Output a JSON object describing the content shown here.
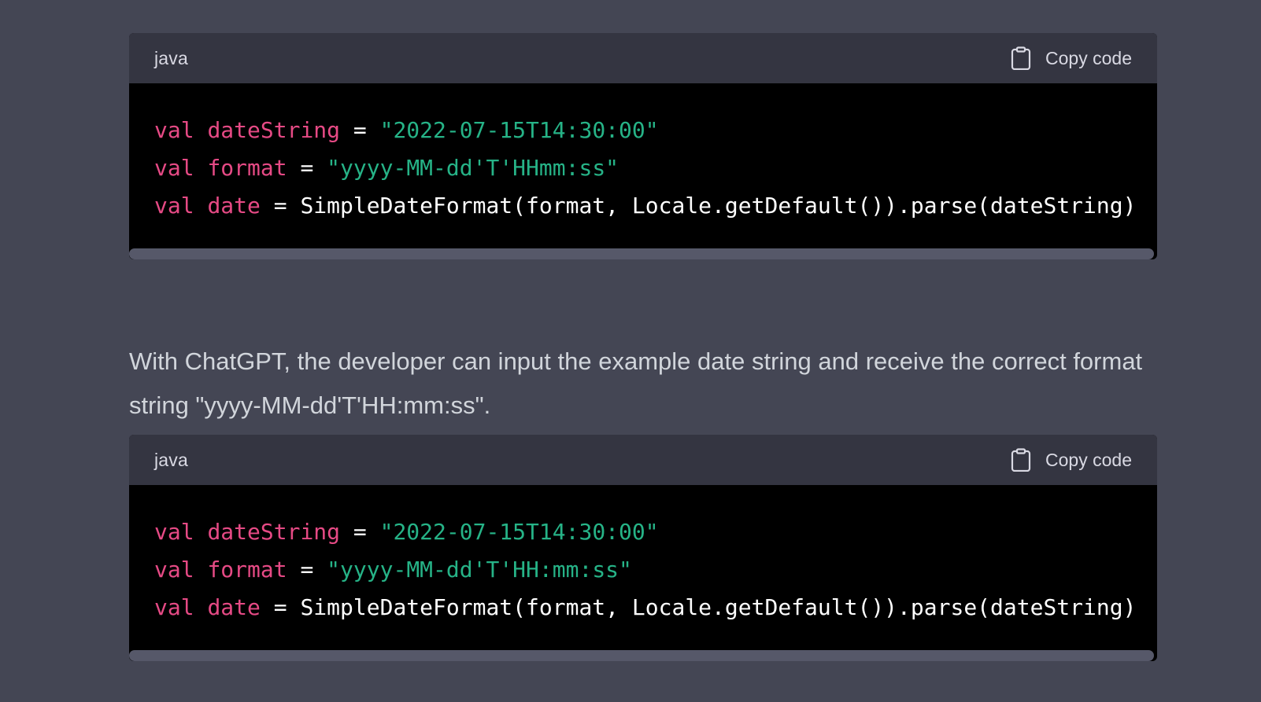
{
  "blocks": [
    {
      "language": "java",
      "copy_label": "Copy code",
      "lines": [
        [
          {
            "t": "val",
            "c": "kw"
          },
          {
            "t": " ",
            "c": "plain"
          },
          {
            "t": "dateString",
            "c": "id"
          },
          {
            "t": " = ",
            "c": "plain"
          },
          {
            "t": "\"2022-07-15T14:30:00\"",
            "c": "str"
          }
        ],
        [
          {
            "t": "val",
            "c": "kw"
          },
          {
            "t": " ",
            "c": "plain"
          },
          {
            "t": "format",
            "c": "id"
          },
          {
            "t": " = ",
            "c": "plain"
          },
          {
            "t": "\"yyyy-MM-dd'T'HHmm:ss\"",
            "c": "str"
          }
        ],
        [
          {
            "t": "val",
            "c": "kw"
          },
          {
            "t": " ",
            "c": "plain"
          },
          {
            "t": "date",
            "c": "id"
          },
          {
            "t": " = SimpleDateFormat(format, Locale.getDefault()).parse(dateString)",
            "c": "plain"
          }
        ]
      ]
    },
    {
      "language": "java",
      "copy_label": "Copy code",
      "lines": [
        [
          {
            "t": "val",
            "c": "kw"
          },
          {
            "t": " ",
            "c": "plain"
          },
          {
            "t": "dateString",
            "c": "id"
          },
          {
            "t": " = ",
            "c": "plain"
          },
          {
            "t": "\"2022-07-15T14:30:00\"",
            "c": "str"
          }
        ],
        [
          {
            "t": "val",
            "c": "kw"
          },
          {
            "t": " ",
            "c": "plain"
          },
          {
            "t": "format",
            "c": "id"
          },
          {
            "t": " = ",
            "c": "plain"
          },
          {
            "t": "\"yyyy-MM-dd'T'HH:mm:ss\"",
            "c": "str"
          }
        ],
        [
          {
            "t": "val",
            "c": "kw"
          },
          {
            "t": " ",
            "c": "plain"
          },
          {
            "t": "date",
            "c": "id"
          },
          {
            "t": " = SimpleDateFormat(format, Locale.getDefault()).parse(dateString)",
            "c": "plain"
          }
        ]
      ]
    }
  ],
  "paragraph": "With ChatGPT, the developer can input the example date string and receive the correct format string \"yyyy-MM-dd'T'HH:mm:ss\".",
  "colors": {
    "background": "#444654",
    "header": "#343541",
    "code_bg": "#000000",
    "keyword": "#e64a85",
    "string": "#26b387"
  },
  "icons": {
    "copy": "clipboard-icon"
  }
}
